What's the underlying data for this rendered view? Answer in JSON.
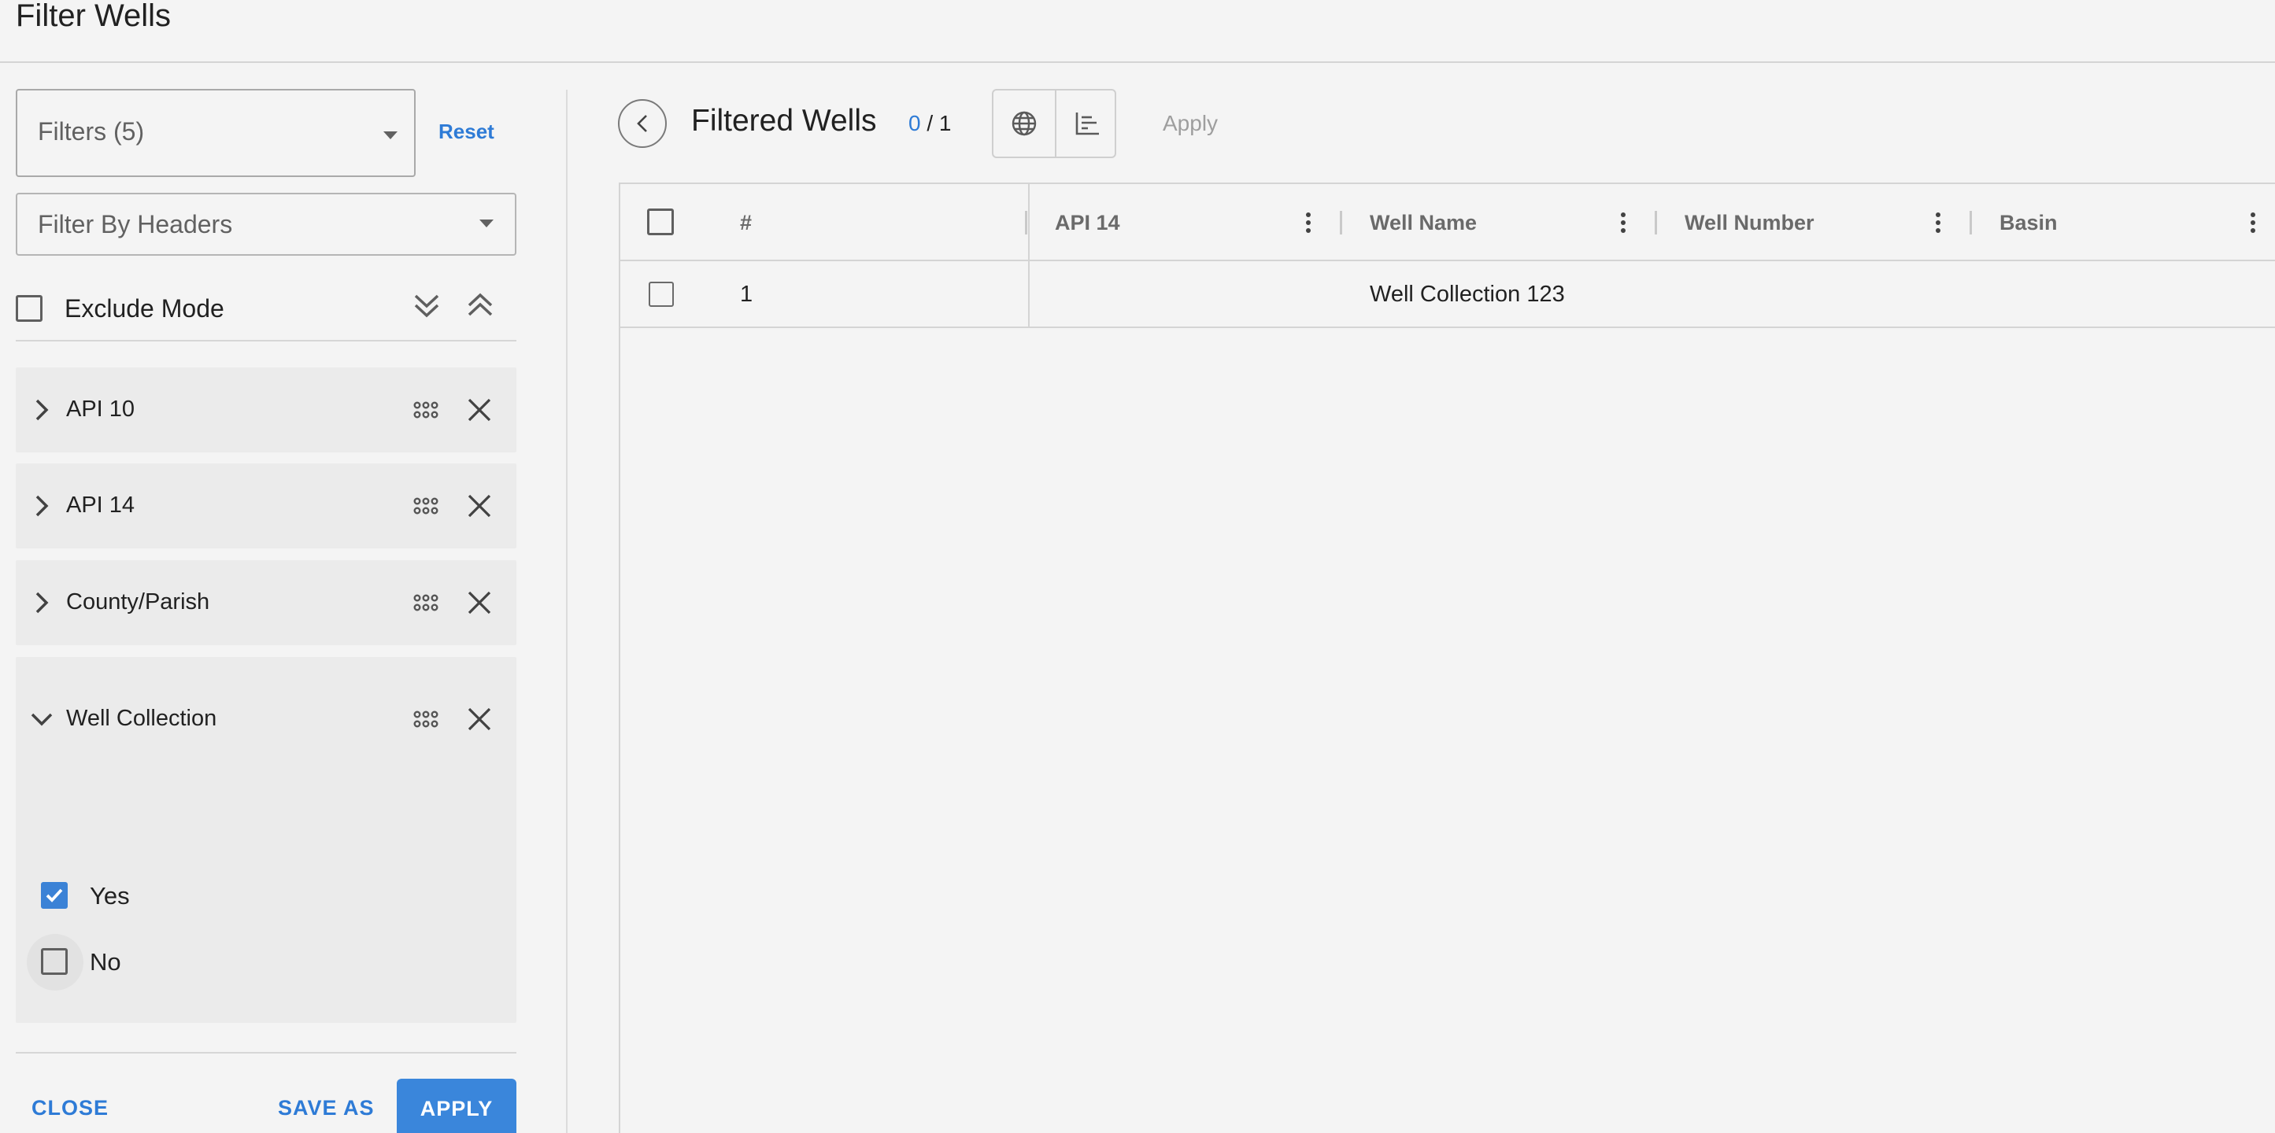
{
  "window": {
    "title": "Filter Wells"
  },
  "left_panel": {
    "filters_select": {
      "value": "Filters (5)"
    },
    "reset_label": "Reset",
    "headers_select": {
      "placeholder": "Filter By Headers"
    },
    "exclude_mode": {
      "label": "Exclude Mode",
      "checked": false
    },
    "filters": [
      {
        "name": "API 10",
        "expanded": false
      },
      {
        "name": "API 14",
        "expanded": false
      },
      {
        "name": "County/Parish",
        "expanded": false
      },
      {
        "name": "Well Collection",
        "expanded": true,
        "options": [
          {
            "label": "Yes",
            "checked": true
          },
          {
            "label": "No",
            "checked": false
          }
        ]
      }
    ],
    "footer": {
      "close_label": "CLOSE",
      "save_as_label": "SAVE AS",
      "apply_label": "APPLY"
    }
  },
  "right_panel": {
    "title": "Filtered Wells",
    "count": {
      "selected": "0",
      "separator": " / ",
      "total": "1"
    },
    "apply_label": "Apply",
    "table": {
      "columns": [
        "#",
        "API 14",
        "Well Name",
        "Well Number",
        "Basin"
      ],
      "rows": [
        {
          "num": "1",
          "api14": "",
          "well_name": "Well Collection 123",
          "well_number": "",
          "basin": ""
        }
      ]
    }
  },
  "colors": {
    "accent": "#3a86db",
    "link": "#2e7bd6",
    "background": "#f4f4f4",
    "card": "#ebebeb"
  }
}
